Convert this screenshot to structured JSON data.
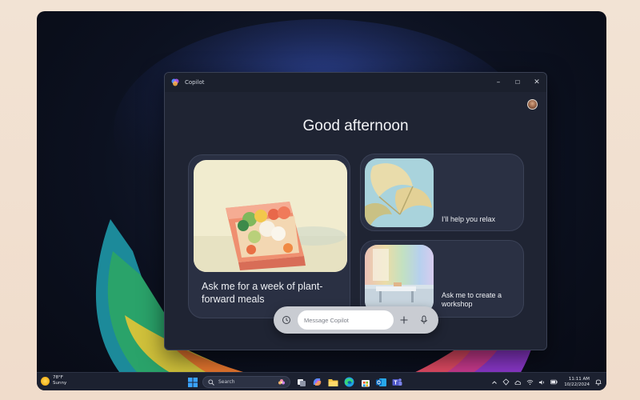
{
  "window": {
    "title": "Copilot",
    "controls": {
      "minimize": "–",
      "maximize": "☐",
      "close": "✕"
    }
  },
  "greeting": "Good afternoon",
  "cards": [
    {
      "text": "Ask me for a week of plant-forward meals",
      "image": "vegetable-meal-prep-painting"
    },
    {
      "text": "I’ll help you relax",
      "image": "lily-pad-leaves-painting"
    },
    {
      "text": "Ask me to create a workshop",
      "image": "sunlit-workshop-room-painting"
    }
  ],
  "composer": {
    "placeholder": "Message Copilot",
    "icons": [
      "history-icon",
      "plus-icon",
      "microphone-icon"
    ]
  },
  "taskbar": {
    "weather": {
      "temp": "78°F",
      "condition": "Sunny"
    },
    "search_label": "Search",
    "apps": [
      "start-icon",
      "task-view-icon",
      "copilot-icon",
      "file-explorer-icon",
      "edge-icon",
      "store-icon",
      "outlook-icon",
      "teams-icon"
    ],
    "clock": {
      "time": "11:11 AM",
      "date": "10/22/2024"
    },
    "tray_icons": [
      "chevron-up-icon",
      "network-icon",
      "cloud-icon",
      "wifi-icon",
      "volume-icon",
      "battery-icon",
      "bell-icon"
    ]
  },
  "colors": {
    "window_bg": "#1f2433",
    "card_bg": "#2a3043",
    "composer_bg": "#c9ccd2",
    "taskbar_bg": "#1c2130"
  }
}
